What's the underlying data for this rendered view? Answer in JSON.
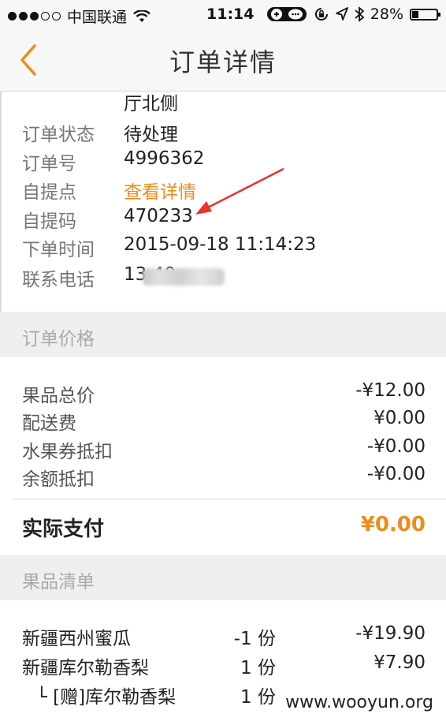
{
  "status_bar": {
    "carrier": "中国联通",
    "time": "11:14",
    "battery": "28%",
    "battery_level": 0.28
  },
  "nav": {
    "title": "订单详情"
  },
  "order_info": {
    "partial_address": "厅北侧",
    "rows": [
      {
        "label": "订单状态",
        "value": "待处理"
      },
      {
        "label": "订单号",
        "value": "4996362"
      },
      {
        "label": "自提点",
        "value": "查看详情"
      },
      {
        "label": "自提码",
        "value": "470233"
      },
      {
        "label": "下单时间",
        "value": "2015-09-18 11:14:23"
      },
      {
        "label": "联系电话",
        "value": "13          40"
      }
    ]
  },
  "price_section": {
    "title": "订单价格",
    "rows": [
      {
        "label": "果品总价",
        "value": "-¥12.00"
      },
      {
        "label": "配送费",
        "value": "¥0.00"
      },
      {
        "label": "水果券抵扣",
        "value": "-¥0.00"
      },
      {
        "label": "余额抵扣",
        "value": "-¥0.00"
      }
    ],
    "actual_label": "实际支付",
    "actual_value": "¥0.00"
  },
  "items_section": {
    "title": "果品清单",
    "items": [
      {
        "name": "新疆西州蜜瓜",
        "qty": "-1 份",
        "price": "-¥19.90"
      },
      {
        "name": "新疆库尔勒香梨",
        "qty": "1 份",
        "price": "¥7.90"
      },
      {
        "name": "└ [赠]库尔勒香梨",
        "qty": "1 份",
        "price": ""
      }
    ]
  },
  "watermark": "www.wooyun.org",
  "colors": {
    "accent": "#f08c1c",
    "arrow": "#e8322b"
  }
}
